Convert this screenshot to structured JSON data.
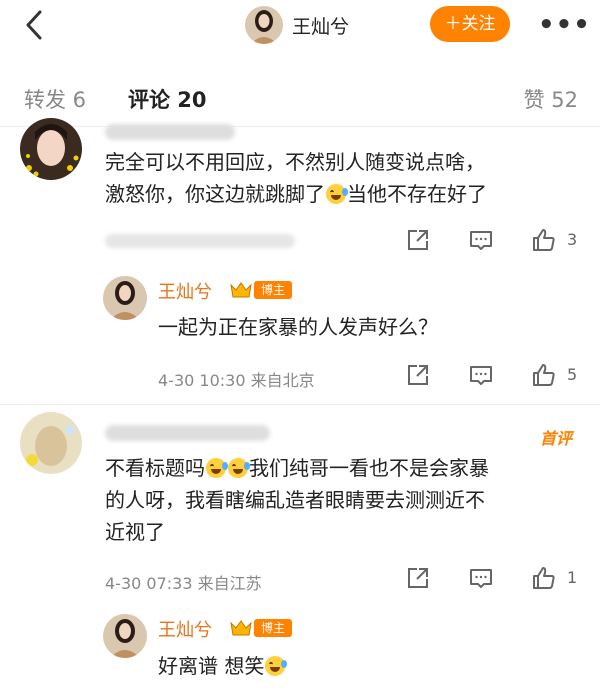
{
  "header": {
    "author_name": "王灿兮",
    "follow_label": "＋关注",
    "more_label": "•••"
  },
  "tabs": {
    "repost": "转发 6",
    "comments": "评论 20",
    "likes": "赞 52"
  },
  "comments": [
    {
      "text_line1": "完全可以不用回应，不然别人随变说点啥，",
      "text_line2a": "激怒你，你这边就跳脚了",
      "text_line2b": "当他不存在好了",
      "like_count": "3",
      "reply": {
        "name": "王灿兮",
        "badge": "博主",
        "text": "一起为正在家暴的人发声好么？",
        "time": "4-30 10:30",
        "location": "来自北京",
        "like_count": "5"
      }
    },
    {
      "first_tag": "首评",
      "text_line1a": "不看标题吗",
      "text_line1b": "我们纯哥一看也不是会家暴",
      "text_line2": "的人呀，我看瞎编乱造者眼睛要去测测近不",
      "text_line3": "近视了",
      "time": "4-30 07:33",
      "location": "来自江苏",
      "like_count": "1",
      "reply": {
        "name": "王灿兮",
        "badge": "博主",
        "text": "好离谱 想笑"
      }
    }
  ],
  "colors": {
    "accent": "#ff8200",
    "name": "#e8731a"
  },
  "icons": {
    "back": "chevron-left-icon",
    "share": "share-icon",
    "comment": "comment-icon",
    "like": "thumbs-up-icon"
  }
}
